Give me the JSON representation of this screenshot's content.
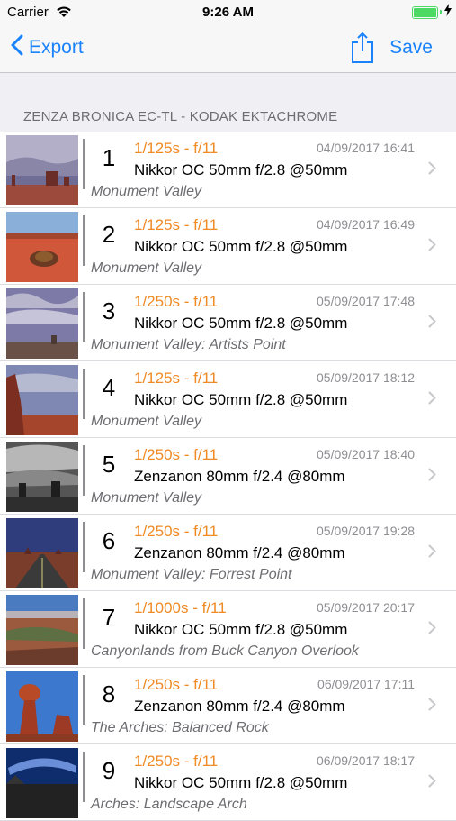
{
  "status_bar": {
    "carrier": "Carrier",
    "time": "9:26 AM"
  },
  "nav": {
    "back_label": "Export",
    "save_label": "Save"
  },
  "section_header": "ZENZA BRONICA EC-TL - KODAK EKTACHROME",
  "frames": [
    {
      "number": "1",
      "exposure": "1/125s - f/11",
      "date": "04/09/2017 16:41",
      "lens": "Nikkor OC 50mm f/2.8 @50mm",
      "location": "Monument Valley",
      "thumb": "monument"
    },
    {
      "number": "2",
      "exposure": "1/125s - f/11",
      "date": "04/09/2017 16:49",
      "lens": "Nikkor OC 50mm f/2.8 @50mm",
      "location": "Monument Valley",
      "thumb": "redsand"
    },
    {
      "number": "3",
      "exposure": "1/250s - f/11",
      "date": "05/09/2017 17:48",
      "lens": "Nikkor OC 50mm f/2.8 @50mm",
      "location": "Monument Valley: Artists Point",
      "thumb": "cloudy"
    },
    {
      "number": "4",
      "exposure": "1/125s - f/11",
      "date": "05/09/2017 18:12",
      "lens": "Nikkor OC 50mm f/2.8 @50mm",
      "location": "Monument Valley",
      "thumb": "butte"
    },
    {
      "number": "5",
      "exposure": "1/250s - f/11",
      "date": "05/09/2017 18:40",
      "lens": "Zenzanon 80mm f/2.4 @80mm",
      "location": "Monument Valley",
      "thumb": "bw"
    },
    {
      "number": "6",
      "exposure": "1/250s - f/11",
      "date": "05/09/2017 19:28",
      "lens": "Zenzanon 80mm f/2.4 @80mm",
      "location": "Monument Valley: Forrest Point",
      "thumb": "road"
    },
    {
      "number": "7",
      "exposure": "1/1000s - f/11",
      "date": "05/09/2017 20:17",
      "lens": "Nikkor OC 50mm f/2.8 @50mm",
      "location": "Canyonlands from Buck Canyon Overlook",
      "thumb": "canyon"
    },
    {
      "number": "8",
      "exposure": "1/250s - f/11",
      "date": "06/09/2017 17:11",
      "lens": "Zenzanon 80mm f/2.4 @80mm",
      "location": "The Arches: Balanced Rock",
      "thumb": "balanced"
    },
    {
      "number": "9",
      "exposure": "1/250s - f/11",
      "date": "06/09/2017 18:17",
      "lens": "Nikkor OC 50mm f/2.8 @50mm",
      "location": "Arches: Landscape Arch",
      "thumb": "arch"
    }
  ],
  "colors": {
    "accent": "#1a82fb",
    "exposure": "#f08a24",
    "battery": "#4cd964"
  },
  "icons": {
    "back": "chevron-left-icon",
    "share": "share-icon",
    "disclosure": "chevron-right-icon",
    "wifi": "wifi-icon",
    "battery": "battery-icon",
    "charging": "bolt-icon"
  }
}
